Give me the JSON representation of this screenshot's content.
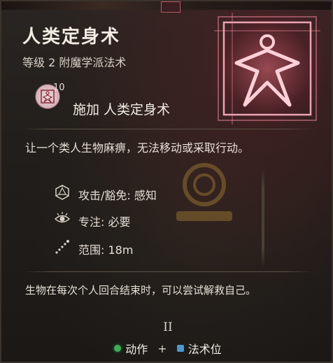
{
  "spell": {
    "title": "人类定身术",
    "subtitle": "等级 2 附魔学派法术",
    "action_level": "10",
    "action_label": "施加 人类定身术",
    "icon": "humanoid-star-icon"
  },
  "description": "让一个类人生物麻痹，无法移动或采取行动。",
  "stats": [
    {
      "icon": "d20-icon",
      "text": "攻击/豁免: 感知"
    },
    {
      "icon": "eye-icon",
      "text": "专注: 必要"
    },
    {
      "icon": "range-icon",
      "text": "范围: 18m"
    }
  ],
  "footer_description": "生物在每次个人回合结束时，可以尝试解救自己。",
  "spell_level_roman": "II",
  "cost": {
    "action_label": "动作",
    "plus": "+",
    "slot_label": "法术位"
  },
  "colors": {
    "action_dot": "#3fae5a",
    "slot_dot": "#4a9ad0",
    "emblem_glow": "#ff8fa3"
  }
}
